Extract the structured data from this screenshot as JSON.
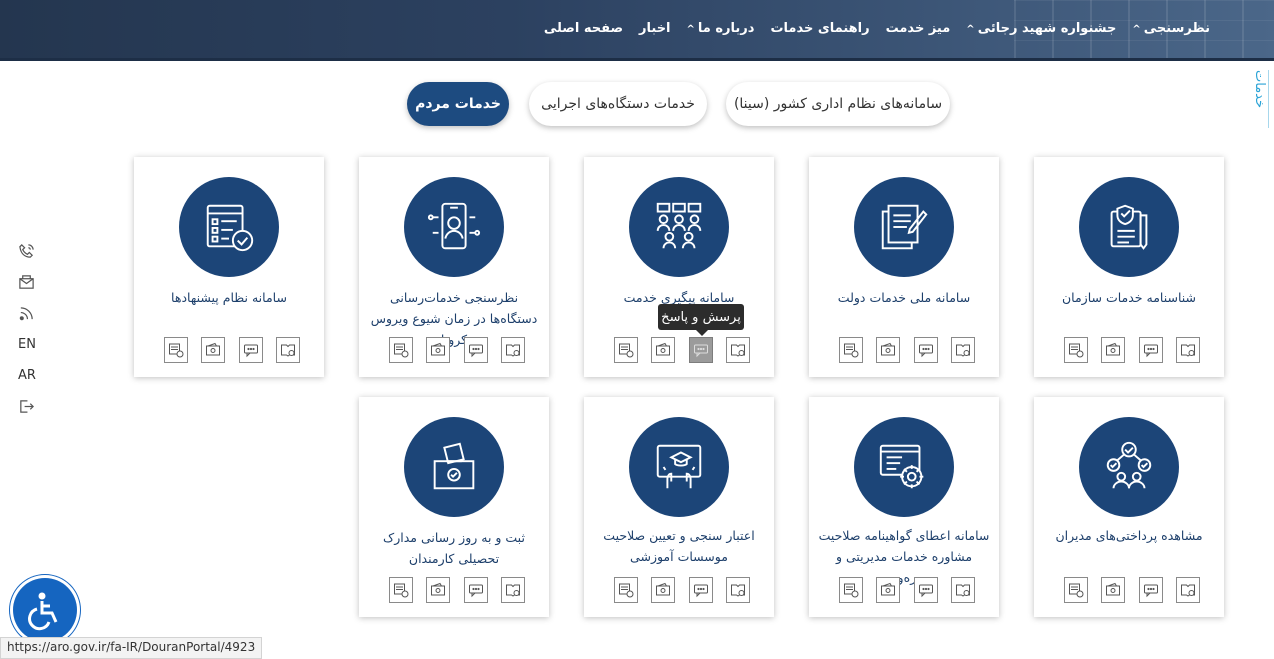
{
  "nav": {
    "items": [
      {
        "label": "صفحه اصلی",
        "chevron": false
      },
      {
        "label": "اخبار",
        "chevron": false
      },
      {
        "label": "درباره ما",
        "chevron": true
      },
      {
        "label": "راهنمای خدمات",
        "chevron": false
      },
      {
        "label": "میز خدمت",
        "chevron": false
      },
      {
        "label": "جشنواره شهید رجائی",
        "chevron": true
      },
      {
        "label": "نظرسنجی",
        "chevron": true
      }
    ]
  },
  "side_label": "خدمات",
  "tabs": [
    "سامانه‌های نظام اداری کشور (سینا)",
    "خدمات دستگاه‌های اجرایی",
    "خدمات مردم"
  ],
  "cards": [
    {
      "title": "شناسنامه خدمات سازمان",
      "icon": "document-shield-icon"
    },
    {
      "title": "سامانه ملی خدمات دولت",
      "icon": "documents-pen-icon"
    },
    {
      "title": "سامانه پیگیری خدمت",
      "icon": "people-chat-icon"
    },
    {
      "title": "نظرسنجی خدمات‌رسانی دستگاه‌ها در زمان شیوع ویروس کرونا",
      "icon": "mobile-user-icon"
    },
    {
      "title": "سامانه نظام پیشنهادها",
      "icon": "checklist-icon"
    },
    {
      "title": "مشاهده پرداختی‌های مدیران",
      "icon": "managers-network-icon"
    },
    {
      "title": "سامانه اعطای گواهینامه صلاحیت مشاوره خدمات مدیریتی و بهره‌وری",
      "icon": "certificate-gear-icon"
    },
    {
      "title": "اعتبار سنجی و تعیین صلاحیت موسسات آموزشی",
      "icon": "tablet-graduation-icon"
    },
    {
      "title": "ثبت و به روز رسانی مدارک تحصیلی کارمندان",
      "icon": "ballot-box-icon"
    }
  ],
  "tooltip": "پرسش و پاسخ",
  "left_bar": {
    "en": "EN",
    "ar": "AR"
  },
  "status_url": "https://aro.gov.ir/fa-IR/DouranPortal/4923",
  "colors": {
    "primary": "#1c4578",
    "link": "#2aa3d6"
  }
}
